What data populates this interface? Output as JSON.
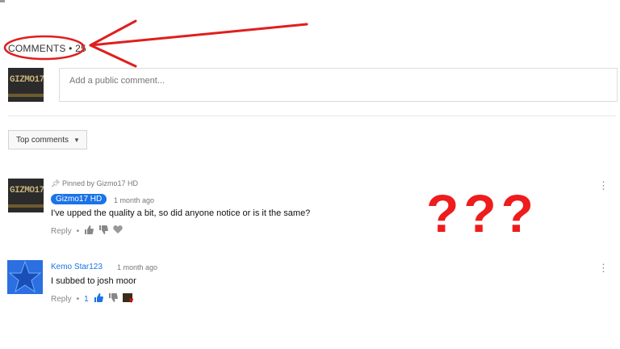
{
  "header": {
    "comments_label": "COMMENTS",
    "count_sep": "•",
    "count": "25"
  },
  "new_comment": {
    "placeholder": "Add a public comment...",
    "avatar_text": "GIZMO17"
  },
  "sort": {
    "label": "Top comments"
  },
  "comments": [
    {
      "pinned_label": "Pinned by Gizmo17 HD",
      "author": "Gizmo17 HD",
      "time": "1 month ago",
      "text": "I've upped the quality a bit, so did anyone notice or is it the same?",
      "reply": "Reply",
      "sep": "•",
      "avatar_text": "GIZMO17"
    },
    {
      "author": "Kemo Star123",
      "time": "1 month ago",
      "text": "I subbed to josh moor",
      "reply": "Reply",
      "sep": "•",
      "likes": "1"
    }
  ],
  "overlay": {
    "annotation_text": "???",
    "annotation_color": "#ee1c1c"
  }
}
